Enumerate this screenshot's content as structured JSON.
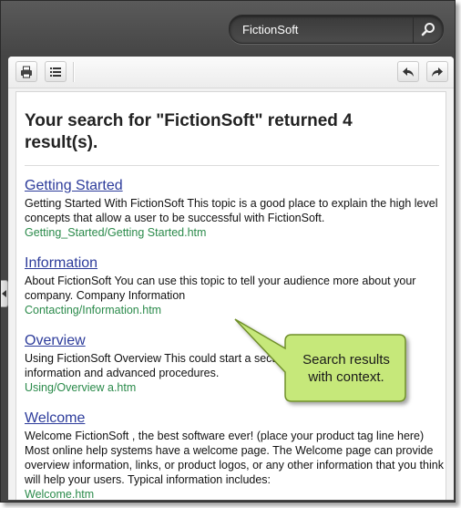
{
  "search": {
    "value": "FictionSoft"
  },
  "toolbar": {
    "print_icon": "printer-icon",
    "toc_icon": "list-icon",
    "back_icon": "arrow-back-icon",
    "forward_icon": "arrow-forward-icon"
  },
  "results_heading": "Your search for \"FictionSoft\" returned 4 result(s).",
  "results": [
    {
      "title": "Getting Started",
      "desc": "Getting Started With FictionSoft This topic is a good place to explain the high level concepts that allow a user to be successful with FictionSoft.",
      "url": "Getting_Started/Getting Started.htm"
    },
    {
      "title": "Information",
      "desc": "About FictionSoft You can use this topic to tell your audience more about your company. Company Information",
      "url": "Contacting/Information.htm"
    },
    {
      "title": "Overview",
      "desc": "Using FictionSoft Overview This could start a section with more in-depth information and advanced procedures.",
      "url": "Using/Overview a.htm"
    },
    {
      "title": "Welcome",
      "desc": "Welcome FictionSoft , the best software ever! (place your product tag line here) Most online help systems have a welcome page. The Welcome page can provide overview information, links, or product logos, or any other information that you think will help your users. Typical information includes:",
      "url": "Welcome.htm"
    }
  ],
  "callout": {
    "text": "Search results with context."
  },
  "colors": {
    "frame": "#4a4a4a",
    "link": "#2d3c9b",
    "url": "#2a8a4a",
    "callout_fill": "#c6e87a",
    "callout_border": "#6f8f2a"
  }
}
